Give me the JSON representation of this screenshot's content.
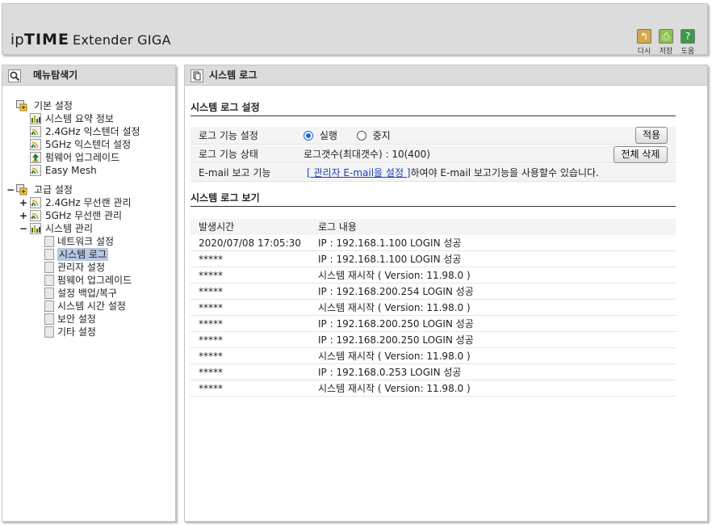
{
  "header": {
    "logo": {
      "ip": "ip",
      "time": "TIME",
      "model": "Extender GIGA"
    },
    "buttons": [
      {
        "name": "undo",
        "label": "다시",
        "glyph": "↰",
        "color": "#d6a84a"
      },
      {
        "name": "save",
        "label": "저장",
        "glyph": "⎙",
        "color": "#8cc24a"
      },
      {
        "name": "help",
        "label": "도움",
        "glyph": "?",
        "color": "#3c9a48"
      }
    ]
  },
  "sidebar": {
    "title": "메뉴탐색기",
    "tree": [
      {
        "label": "기본 설정",
        "toggle": "",
        "icon": "folder-icon"
      },
      {
        "label": "시스템 요약 정보",
        "icon": "chart-icon"
      },
      {
        "label": "2.4GHz 익스텐더 설정",
        "icon": "wireless-icon"
      },
      {
        "label": "5GHz 익스텐더 설정",
        "icon": "wireless-icon"
      },
      {
        "label": "펌웨어 업그레이드",
        "icon": "upgrade-icon"
      },
      {
        "label": "Easy Mesh",
        "icon": "wireless-icon"
      },
      {
        "label": "고급 설정",
        "toggle": "−",
        "icon": "folder-icon"
      },
      {
        "label": "2.4GHz 무선랜 관리",
        "toggle": "+",
        "icon": "wireless-icon"
      },
      {
        "label": "5GHz 무선랜 관리",
        "toggle": "+",
        "icon": "wireless-icon"
      },
      {
        "label": "시스템 관리",
        "toggle": "−",
        "icon": "chart-icon"
      },
      {
        "label": "네트워크 설정",
        "icon": "page-icon"
      },
      {
        "label": "시스템 로그",
        "icon": "page-icon",
        "selected": true
      },
      {
        "label": "관리자 설정",
        "icon": "page-icon"
      },
      {
        "label": "펌웨어 업그레이드",
        "icon": "page-icon"
      },
      {
        "label": "설정 백업/복구",
        "icon": "page-icon"
      },
      {
        "label": "시스템 시간 설정",
        "icon": "page-icon"
      },
      {
        "label": "보안 설정",
        "icon": "page-icon"
      },
      {
        "label": "기타 설정",
        "icon": "page-icon"
      }
    ]
  },
  "main": {
    "title": "시스템 로그",
    "settings": {
      "section_title": "시스템 로그 설정",
      "log_function_label": "로그 기능 설정",
      "radio_run": "실행",
      "radio_stop": "중지",
      "radio_selected": "실행",
      "apply_button": "적용",
      "log_status_label": "로그 기능 상태",
      "log_status_value": "로그갯수(최대갯수) : 10(400)",
      "delete_all_button": "전체 삭제",
      "email_label": "E-mail 보고 기능",
      "email_link": "[ 관리자 E-mail을 설정 ]",
      "email_text": "하여야 E-mail 보고기능을 사용할수 있습니다."
    },
    "log": {
      "section_title": "시스템 로그 보기",
      "columns": [
        "발생시간",
        "로그 내용"
      ],
      "rows": [
        {
          "time": "2020/07/08 17:05:30",
          "msg": "IP : 192.168.1.100 LOGIN 성공"
        },
        {
          "time": "*****",
          "msg": "IP : 192.168.1.100 LOGIN 성공"
        },
        {
          "time": "*****",
          "msg": "시스템 재시작 ( Version: 11.98.0 )"
        },
        {
          "time": "*****",
          "msg": "IP : 192.168.200.254 LOGIN 성공"
        },
        {
          "time": "*****",
          "msg": "시스템 재시작 ( Version: 11.98.0 )"
        },
        {
          "time": "*****",
          "msg": "IP : 192.168.200.250 LOGIN 성공"
        },
        {
          "time": "*****",
          "msg": "IP : 192.168.200.250 LOGIN 성공"
        },
        {
          "time": "*****",
          "msg": "시스템 재시작 ( Version: 11.98.0 )"
        },
        {
          "time": "*****",
          "msg": "IP : 192.168.0.253 LOGIN 성공"
        },
        {
          "time": "*****",
          "msg": "시스템 재시작 ( Version: 11.98.0 )"
        }
      ]
    }
  }
}
